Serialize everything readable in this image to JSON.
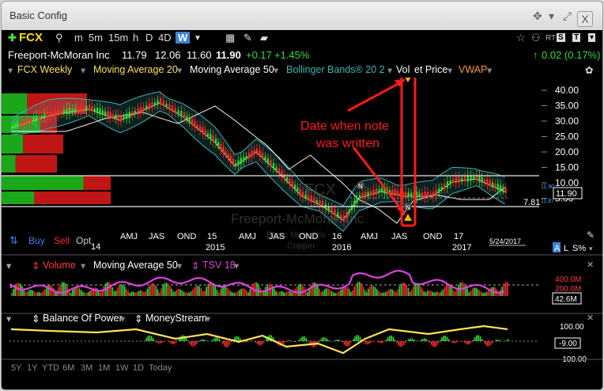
{
  "window": {
    "title": "Basic Config",
    "close": "X"
  },
  "toolbar": {
    "symbol": "FCX",
    "intervals": [
      "m",
      "5m",
      "15m",
      "h",
      "D",
      "4D",
      "W"
    ],
    "selected_interval": "W",
    "right_badges": [
      "RT",
      "S",
      "T"
    ]
  },
  "quote": {
    "company": "Freeport-McMoran Inc",
    "open": "11.79",
    "high": "12.06",
    "low": "11.60",
    "last": "11.90",
    "change": "+0.17",
    "change_pct": "+1.45%",
    "right_change": "0.02 (0.17%)"
  },
  "legend": {
    "items": [
      {
        "label": "FCX Weekly",
        "color": "#ffe25a"
      },
      {
        "label": "Moving Average 20",
        "color": "#ffe25a"
      },
      {
        "label": "Moving Average 50",
        "color": "#ffffff"
      },
      {
        "label": "Bollinger Bands® 20 2",
        "color": "#3fb4b4"
      },
      {
        "label": "Vol",
        "color": "#ffffff"
      },
      {
        "label": "et Price",
        "color": "#ffffff"
      },
      {
        "label": "VWAP",
        "color": "#ff9a28"
      }
    ]
  },
  "price_axis": {
    "ticks": [
      "40.00",
      "35.00",
      "30.00",
      "25.00",
      "20.00",
      "15.00",
      "10.00",
      "5.00"
    ],
    "current": "11.90",
    "hi_small": "11.90",
    "lo_small": "11.87",
    "level": "7.81"
  },
  "watermark": {
    "symbol": "FCX",
    "company": "Freeport-McMoran Inc",
    "sector": "Basic Materials",
    "industry": "Copper"
  },
  "time_axis": {
    "labels": [
      "AMJ",
      "JAS",
      "OND",
      "15",
      "AMJ",
      "JAS",
      "OND",
      "16",
      "AMJ",
      "JAS",
      "OND",
      "17"
    ],
    "years": [
      "2015",
      "2016",
      "2017"
    ],
    "fragment": "14",
    "date": "5/24/2017"
  },
  "trade": {
    "buy": "Buy",
    "sell": "Sell",
    "opt": "Opt"
  },
  "axis_ctrl": {
    "a": "A",
    "l": "L",
    "s": "S%"
  },
  "markers": {
    "note": "N"
  },
  "annotation": {
    "text_line1": "Date when note",
    "text_line2": "was written",
    "color": "#ff1a1a"
  },
  "volume_pane": {
    "items": [
      {
        "label": "Volume",
        "color": "#ff3a3a"
      },
      {
        "label": "Moving Average 50",
        "color": "#ffffff"
      },
      {
        "label": "TSV 18",
        "color": "#e040e0"
      }
    ],
    "ticks": [
      "400.0M",
      "200.0M"
    ],
    "current": "42.6M"
  },
  "bop_pane": {
    "items": [
      {
        "label": "Balance Of Power",
        "color": "#ffffff"
      },
      {
        "label": "MoneyStream",
        "color": "#ffffff"
      }
    ],
    "ticks": [
      "100.00",
      "-100.00"
    ],
    "current": "-9.00"
  },
  "periods": [
    "5Y",
    "1Y",
    "YTD",
    "6M",
    "3M",
    "1M",
    "1W",
    "1D",
    "Today"
  ],
  "colors": {
    "up": "#2fdc39",
    "down": "#ff2a2a",
    "band": "#3fb4b4",
    "ma20": "#ffe25a",
    "ma50": "#f5f5f5"
  }
}
